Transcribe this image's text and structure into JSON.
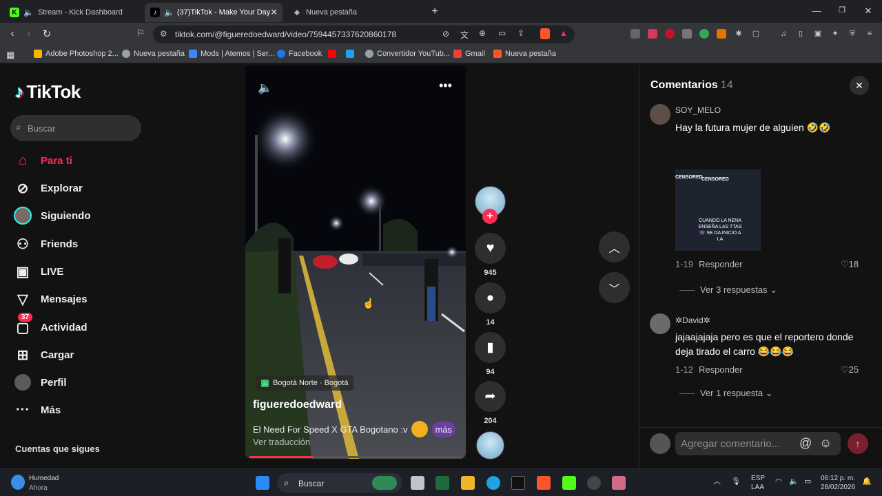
{
  "browser": {
    "tabs": [
      {
        "title": "Stream - Kick Dashboard",
        "fav": "K",
        "fav_color": "#53fc18",
        "active": false
      },
      {
        "title": "(37)TikTok - Make Your Day",
        "fav": "♪",
        "fav_color": "#000000",
        "active": true
      },
      {
        "title": "Nueva pestaña",
        "fav": "◈",
        "fav_color": "#35363a",
        "active": false
      }
    ],
    "new_tab_icon": "+",
    "url": "tiktok.com/@figueredoedward/video/7594457337620860178",
    "bookmarks": [
      {
        "label": "Adobe Photoshop 2...",
        "color": "#f4b400"
      },
      {
        "label": "Nueva pestaña",
        "color": "#9aa0a6"
      },
      {
        "label": "Mods | Atemos | Ser...",
        "color": "#4285f4"
      },
      {
        "label": "Facebook",
        "color": "#1877f2"
      },
      {
        "label": "",
        "color": "#ff0000"
      },
      {
        "label": "",
        "color": "#1da1f2"
      },
      {
        "label": "Convertidor YouTub...",
        "color": "#9aa0a6"
      },
      {
        "label": "Gmail",
        "color": "#ea4335"
      },
      {
        "label": "Nueva pestaña",
        "color": "#fb542b"
      }
    ]
  },
  "tiktok": {
    "logo": "TikTok",
    "search_placeholder": "Buscar",
    "nav": [
      {
        "label": "Para ti",
        "icon": "home-icon",
        "active": true
      },
      {
        "label": "Explorar",
        "icon": "compass-icon",
        "active": false
      },
      {
        "label": "Siguiendo",
        "icon": "following-avatar-icon",
        "active": false
      },
      {
        "label": "Friends",
        "icon": "friends-icon",
        "active": false
      },
      {
        "label": "LIVE",
        "icon": "live-icon",
        "active": false
      },
      {
        "label": "Mensajes",
        "icon": "messages-icon",
        "active": false
      },
      {
        "label": "Actividad",
        "icon": "activity-icon",
        "active": false,
        "badge": "37"
      },
      {
        "label": "Cargar",
        "icon": "upload-icon",
        "active": false
      },
      {
        "label": "Perfil",
        "icon": "profile-avatar-icon",
        "active": false
      },
      {
        "label": "Más",
        "icon": "more-icon",
        "active": false
      }
    ],
    "following_title": "Cuentas que sigues",
    "video": {
      "location": "Bogotá Norte · Bogotá",
      "author": "figueredoedward",
      "caption": "El Need For Speed X GTA Bogotano :v",
      "more_label": "más",
      "translate_label": "Ver traducción",
      "progress": 0.3
    },
    "actions": {
      "likes": "945",
      "comments": "14",
      "saves": "94",
      "shares": "204"
    },
    "comments_panel": {
      "title": "Comentarios",
      "count": "14",
      "items": [
        {
          "user": "SOY_MELO",
          "text": "Hay la futura mujer de alguien 🤣🤣",
          "date": "1-19",
          "reply_label": "Responder",
          "likes": "18",
          "view_replies": "Ver 3 respuestas"
        },
        {
          "user": "✲David✲",
          "text": "jajaajajaja pero es que el reportero donde deja tirado el carro 😂😂😂",
          "date": "1-12",
          "reply_label": "Responder",
          "likes": "25",
          "view_replies": "Ver 1 respuesta"
        }
      ],
      "input_placeholder": "Agregar comentario...",
      "image_labels": [
        "CENSORED",
        "CENSORED"
      ],
      "image_text": "CUANDO LA NENA ENSEÑA LAS TTAS 👾 SE DA INICIO A LA"
    }
  },
  "taskbar": {
    "weather_title": "Humedad",
    "weather_sub": "Ahora",
    "search_label": "Buscar",
    "lang_top": "ESP",
    "lang_bottom": "LAA",
    "time": "06:12 p. m.",
    "date": "28/02/2026"
  }
}
